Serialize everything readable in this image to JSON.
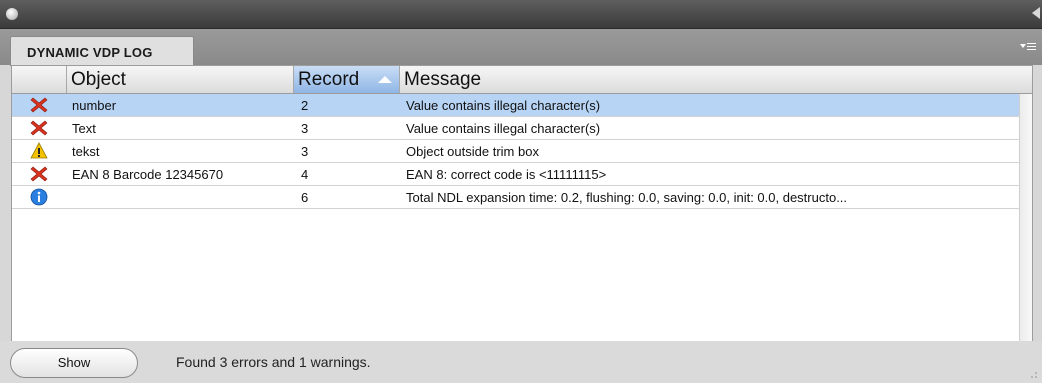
{
  "panel": {
    "tab_title": "DYNAMIC VDP LOG"
  },
  "columns": {
    "object": "Object",
    "record": "Record",
    "message": "Message",
    "sorted_by": "record",
    "sort_direction": "ascending"
  },
  "rows": [
    {
      "status": "error",
      "icon": "error-x-icon",
      "object": "number",
      "record": "2",
      "message": "Value contains illegal character(s)",
      "selected": true
    },
    {
      "status": "error",
      "icon": "error-x-icon",
      "object": "Text",
      "record": "3",
      "message": "Value contains illegal character(s)",
      "selected": false
    },
    {
      "status": "warning",
      "icon": "warning-triangle-icon",
      "object": "tekst",
      "record": "3",
      "message": "Object outside trim box",
      "selected": false
    },
    {
      "status": "error",
      "icon": "error-x-icon",
      "object": "EAN 8  Barcode 12345670",
      "record": "4",
      "message": "EAN 8: correct code is <11111115>",
      "selected": false
    },
    {
      "status": "info",
      "icon": "info-icon",
      "object": "",
      "record": "6",
      "message": "Total NDL expansion time: 0.2, flushing: 0.0, saving: 0.0, init: 0.0, destructo...",
      "selected": false
    }
  ],
  "footer": {
    "show_label": "Show",
    "status_text": "Found 3 errors and 1 warnings."
  },
  "colors": {
    "selection": "#b7d4f5",
    "sorted_header": "#8fb6e6",
    "error": "#d9331f",
    "warning": "#f3c300",
    "info": "#2a7fe0"
  }
}
